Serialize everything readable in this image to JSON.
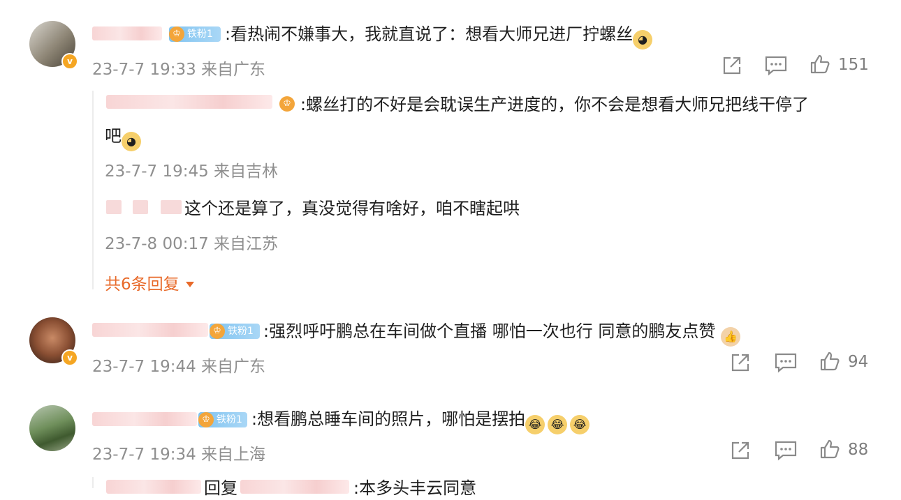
{
  "comments": [
    {
      "text": ":看热闹不嫌事大，我就直说了：想看大师兄进厂拧螺丝",
      "badge": "铁粉1",
      "time": "23-7-7 19:33 来自广东",
      "likes": "151",
      "replies": [
        {
          "text": ":螺丝打的不好是会耽误生产进度的，你不会是想看大师兄把线干停了",
          "text2": "吧",
          "time": "23-7-7 19:45 来自吉林"
        },
        {
          "text": "这个还是算了，真没觉得有啥好，咱不瞎起哄",
          "time": "23-7-8 00:17 来自江苏"
        }
      ],
      "more_replies": "共6条回复"
    },
    {
      "text": ":强烈呼吁鹏总在车间做个直播  哪怕一次也行 同意的鹏友点赞",
      "badge": "铁粉1",
      "time": "23-7-7 19:44 来自广东",
      "likes": "94"
    },
    {
      "text": ":想看鹏总睡车间的照片，哪怕是摆拍",
      "badge": "铁粉1",
      "time": "23-7-7 19:34 来自上海",
      "likes": "88",
      "partial_reply": {
        "word": "回复",
        "text": ":本多头丰云同意"
      }
    }
  ],
  "icons": {
    "share": "share-icon",
    "comment": "comment-icon",
    "like": "thumbs-up-icon",
    "verified": "verified-badge-icon",
    "fan": "crown-icon",
    "dropdown": "caret-down-icon"
  },
  "colors": {
    "more_link": "#e86a2a",
    "fan_badge": "#7fc3f0",
    "verified": "#f5a623"
  }
}
